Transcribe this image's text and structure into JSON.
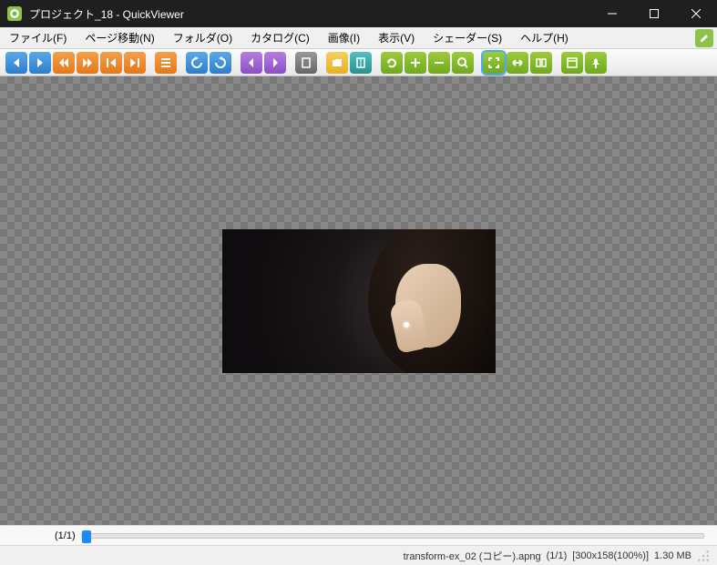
{
  "window": {
    "title": "プロジェクト_18 - QuickViewer"
  },
  "menu": {
    "items": [
      "ファイル(F)",
      "ページ移動(N)",
      "フォルダ(O)",
      "カタログ(C)",
      "画像(I)",
      "表示(V)",
      "シェーダー(S)",
      "ヘルプ(H)"
    ]
  },
  "toolbar": {
    "buttons": [
      {
        "name": "prev-page",
        "color": "blue",
        "icon": "tri-left"
      },
      {
        "name": "next-page",
        "color": "blue",
        "icon": "tri-right"
      },
      {
        "name": "rewind",
        "color": "orange",
        "icon": "dbl-left"
      },
      {
        "name": "forward",
        "color": "orange",
        "icon": "dbl-right"
      },
      {
        "name": "first",
        "color": "orange",
        "icon": "bar-left"
      },
      {
        "name": "last",
        "color": "orange",
        "icon": "bar-right"
      },
      {
        "sep": true
      },
      {
        "name": "list",
        "color": "orange",
        "icon": "list"
      },
      {
        "sep": true
      },
      {
        "name": "rotate-left",
        "color": "blue",
        "icon": "rot-l"
      },
      {
        "name": "rotate-right",
        "color": "blue",
        "icon": "rot-r"
      },
      {
        "sep": true
      },
      {
        "name": "bookmark-prev",
        "color": "purple",
        "icon": "bm-l"
      },
      {
        "name": "bookmark-next",
        "color": "purple",
        "icon": "bm-r"
      },
      {
        "sep": true
      },
      {
        "name": "single-page",
        "color": "gray",
        "icon": "page"
      },
      {
        "sep": true
      },
      {
        "name": "folder",
        "color": "yellow",
        "icon": "folder"
      },
      {
        "name": "book",
        "color": "teal",
        "icon": "book"
      },
      {
        "sep": true
      },
      {
        "name": "refresh",
        "color": "green",
        "icon": "refresh"
      },
      {
        "name": "zoom-in",
        "color": "green",
        "icon": "plus"
      },
      {
        "name": "zoom-out",
        "color": "green",
        "icon": "minus"
      },
      {
        "name": "zoom",
        "color": "green",
        "icon": "zoom"
      },
      {
        "sep": true
      },
      {
        "name": "fit-screen",
        "color": "green",
        "icon": "fit",
        "active": true
      },
      {
        "name": "fit-width",
        "color": "green",
        "icon": "fitw"
      },
      {
        "name": "spread",
        "color": "green",
        "icon": "spread"
      },
      {
        "sep": true
      },
      {
        "name": "window-mode",
        "color": "green",
        "icon": "window"
      },
      {
        "name": "pin",
        "color": "green",
        "icon": "pin"
      }
    ]
  },
  "slider": {
    "page_label": "(1/1)"
  },
  "status": {
    "filename": "transform-ex_02 (コピー).apng",
    "page": "(1/1)",
    "dims": "[300x158(100%)]",
    "size": "1.30 MB"
  }
}
